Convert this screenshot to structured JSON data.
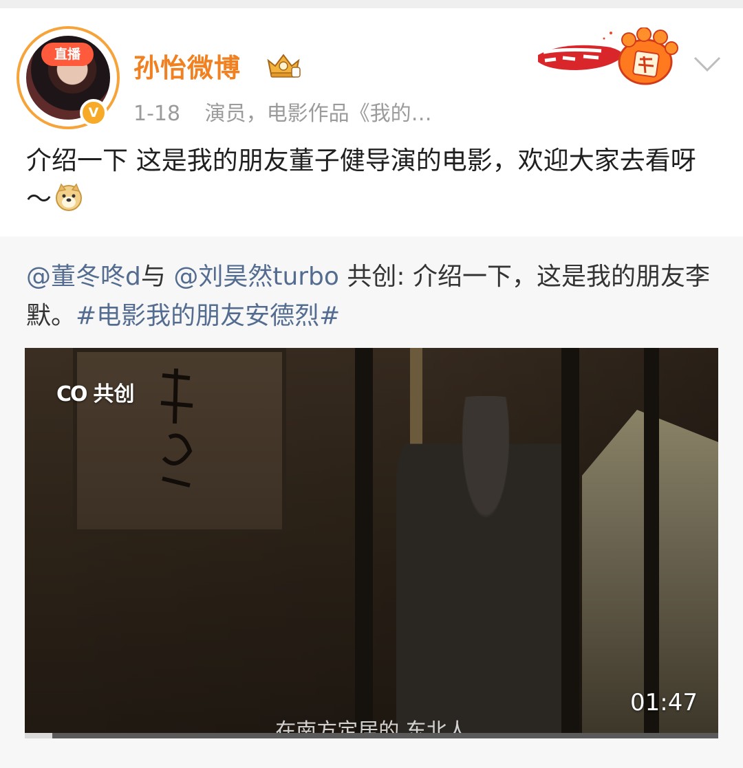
{
  "post": {
    "avatar": {
      "live_label": "直播",
      "verified_mark": "V"
    },
    "author": "孙怡微博",
    "date": "1-18",
    "bio": "演员，电影作品《我的…",
    "text": "介绍一下 这是我的朋友董子健导演的电影，欢迎大家去看呀～",
    "icons": [
      "crown-vip-icon",
      "tiger-year-banner-icon",
      "chevron-down-icon",
      "doge-emoji-icon"
    ]
  },
  "repost": {
    "mention1": "@董冬咚d",
    "joiner": "与",
    "mention2": "@刘昊然turbo",
    "text_mid": "共创: 介绍一下，这是我的朋友李默。",
    "hashtag": "#电影我的朋友安德烈#"
  },
  "video": {
    "co_logo": "CO",
    "co_label": "共创",
    "duration": "01:47",
    "subtitle": "在南方定居的 东北人",
    "progress": 0.04
  },
  "colors": {
    "username": "#f08020",
    "link": "#536c8f",
    "live_badge": "#ff5a3c",
    "avatar_ring": "#f6a33a"
  }
}
